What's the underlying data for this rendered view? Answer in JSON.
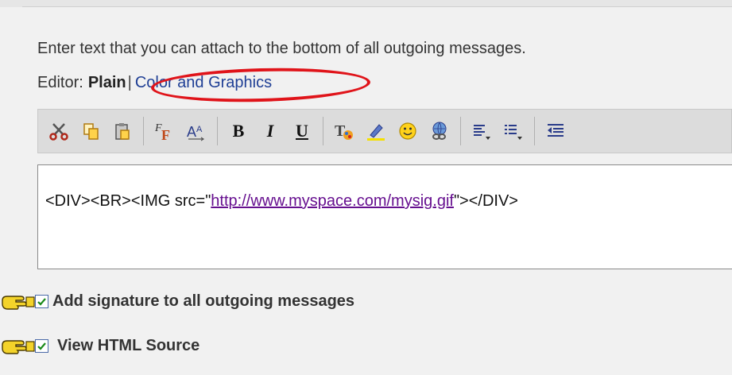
{
  "intro_text": "Enter text that you can attach to the bottom of all outgoing messages.",
  "editor": {
    "label": "Editor:",
    "plain_label": "Plain",
    "separator": "|",
    "color_graphics_label": "Color and Graphics"
  },
  "toolbar": {
    "buttons": [
      "cut-icon",
      "copy-icon",
      "paste-icon",
      "font-face-icon",
      "font-size-icon",
      "bold",
      "italic",
      "underline",
      "text-color-icon",
      "highlight-icon",
      "emoticon-icon",
      "insert-link-icon",
      "align-icon",
      "list-icon",
      "outdent-icon"
    ],
    "bold_label": "B",
    "italic_label": "I",
    "underline_label": "U"
  },
  "content": {
    "prefix": "<DIV><BR><IMG src=\"",
    "link": "http://www.myspace.com/mysig.gif",
    "suffix": "\"></DIV>"
  },
  "options": {
    "add_signature": {
      "label": "Add signature to all outgoing messages",
      "checked": true
    },
    "view_html": {
      "label": "View HTML Source",
      "checked": true
    }
  },
  "colors": {
    "highlight_oval": "#e0141a",
    "link": "#1f3f95",
    "visited_link": "#660f8f"
  }
}
